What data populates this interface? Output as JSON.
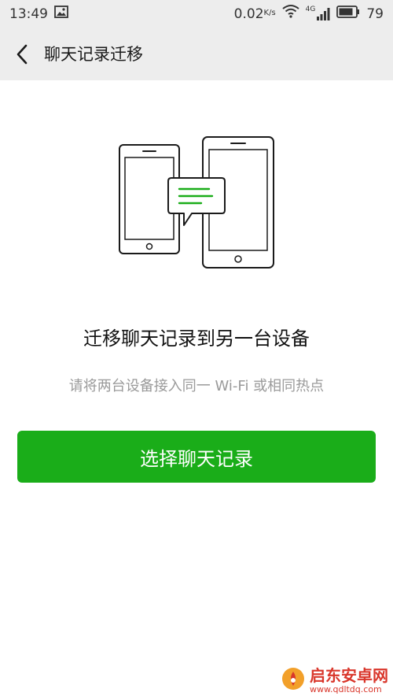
{
  "status_bar": {
    "time": "13:49",
    "net_speed": "0.02",
    "net_speed_unit": "K/s",
    "network_type": "4G",
    "battery": "79",
    "icons": [
      "image-icon",
      "wifi-icon",
      "signal-icon",
      "battery-icon"
    ]
  },
  "nav": {
    "back_icon": "chevron-left-icon",
    "title": "聊天记录迁移"
  },
  "illustration": {
    "icons": [
      "phone-icon",
      "tablet-icon",
      "chat-bubble-icon"
    ],
    "accent_color": "#1aad19"
  },
  "main": {
    "headline": "迁移聊天记录到另一台设备",
    "subtitle": "请将两台设备接入同一 Wi-Fi 或相同热点",
    "button_label": "选择聊天记录",
    "button_color": "#1aad19"
  },
  "watermark": {
    "name": "启东安卓网",
    "url": "www.qdltdq.com"
  }
}
